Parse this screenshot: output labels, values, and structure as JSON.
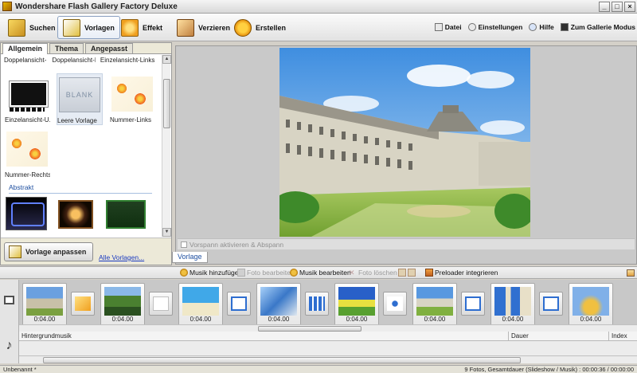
{
  "window": {
    "title": "Wondershare Flash Gallery Factory Deluxe",
    "minimize": "_",
    "maximize": "□",
    "close": "×"
  },
  "toolbar": {
    "nav": [
      {
        "label": "Suchen",
        "icon": "folder-icon"
      },
      {
        "label": "Vorlagen",
        "icon": "template-icon",
        "active": true
      },
      {
        "label": "Effekt",
        "icon": "effect-icon"
      },
      {
        "label": "Verzieren",
        "icon": "decorate-icon"
      },
      {
        "label": "Erstellen",
        "icon": "create-icon"
      }
    ],
    "right": [
      {
        "label": "Datei",
        "icon": "file-icon"
      },
      {
        "label": "Einstellungen",
        "icon": "settings-icon"
      },
      {
        "label": "Hilfe",
        "icon": "help-icon"
      },
      {
        "label": "Zum Gallerie Modus",
        "icon": "gallery-mode-icon"
      }
    ]
  },
  "template_panel": {
    "tabs": [
      "Allgemein",
      "Thema",
      "Angepasst"
    ],
    "active_tab": "Allgemein",
    "top_labels": [
      "Doppelansicht-L...",
      "Doppelansicht-L...",
      "Einzelansicht-Links"
    ],
    "row1": [
      {
        "caption": "Einzelansicht-U..."
      },
      {
        "caption": "Leere Vorlage",
        "thumb_text": "BLANK",
        "selected": true
      },
      {
        "caption": "Nummer-Links"
      }
    ],
    "row2": [
      {
        "caption": "Nummer-Rechts"
      }
    ],
    "section": "Abstrakt",
    "button_label": "Vorlage anpassen",
    "all_link": "Alle Vorlagen..."
  },
  "preview": {
    "footer_checkbox_label": "Vorspann aktivieren & Abspann",
    "bottom_tab": "Vorlage"
  },
  "actions": [
    {
      "label": "Musik hinzufügen",
      "enabled": true
    },
    {
      "label": "Foto bearbeiten",
      "enabled": false
    },
    {
      "label": "Musik bearbeiten",
      "enabled": true
    },
    {
      "label": "Foto löschen",
      "enabled": false
    },
    {
      "label": "Preloader integrieren",
      "enabled": true
    }
  ],
  "filmstrip": {
    "duration": "0:04.00"
  },
  "music_track": {
    "col_music": "Hintergrundmusik",
    "col_duration": "Dauer",
    "col_index": "Index"
  },
  "status": {
    "left": "Unbenannt *",
    "right": "9 Fotos, Gesamtdauer (Slideshow / Musik) : 00:00:36 / 00:00:00"
  }
}
